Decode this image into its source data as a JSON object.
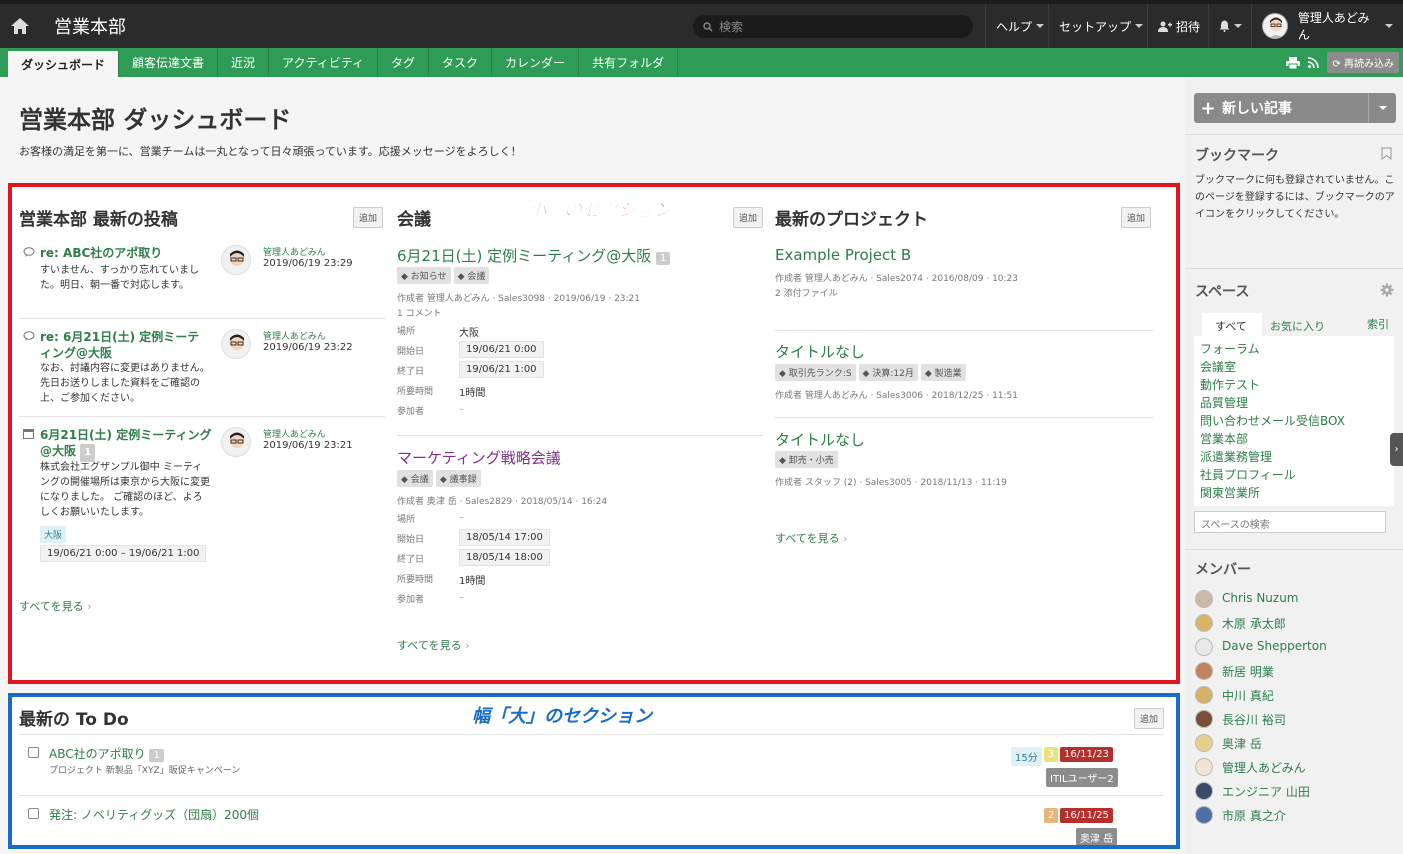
{
  "topbar": {
    "site_title": "営業本部",
    "search_placeholder": "検索",
    "help": "ヘルプ",
    "setup": "セットアップ",
    "invite": "招待",
    "user": "管理人あどみん"
  },
  "tabs": [
    "ダッシュボード",
    "顧客伝達文書",
    "近況",
    "アクティビティ",
    "タグ",
    "タスク",
    "カレンダー",
    "共有フォルダ"
  ],
  "reload": "再読み込み",
  "page": {
    "title": "営業本部 ダッシュボード",
    "description": "お客様の満足を第一に、営業チームは一丸となって日々頑張っています。応援メッセージをよろしく！"
  },
  "annotations": {
    "small": "幅「小」のセクション",
    "large": "幅「大」のセクション"
  },
  "add_label": "追加",
  "see_all": "すべてを見る",
  "posts": {
    "title": "営業本部 最新の投稿",
    "items": [
      {
        "title": "re: ABC社のアポ取り",
        "text": "すいません、すっかり忘れていました。明日、朝一番で対応します。",
        "author": "管理人あどみん",
        "date": "2019/06/19 23:29"
      },
      {
        "title": "re: 6月21日(土) 定例ミーティング@大阪",
        "text": "なお、討議内容に変更はありません。先日お送りしました資料をご確認の上、ご参加ください。",
        "author": "管理人あどみん",
        "date": "2019/06/19 23:22"
      },
      {
        "title": "6月21日(土) 定例ミーティング@大阪",
        "badge": "1",
        "text": "株式会社エグザンプル御中 ミーティングの開催場所は東京から大阪に変更になりました。 ご確認のほど、よろしくお願いいたします。",
        "author": "管理人あどみん",
        "date": "2019/06/19 23:21",
        "place": "大阪",
        "range": "19/06/21 0:00 – 19/06/21 1:00"
      }
    ]
  },
  "meetings": {
    "title": "会議",
    "labels": {
      "place": "場所",
      "start": "開始日",
      "end": "終了日",
      "duration": "所要時間",
      "attendees": "参加者"
    },
    "items": [
      {
        "title": "6月21日(土) 定例ミーティング@大阪",
        "badge": "1",
        "tags": [
          "お知らせ",
          "会議"
        ],
        "meta": "作成者 管理人あどみん · Sales3098 · 2019/06/19 · 23:21",
        "comments": "1 コメント",
        "place": "大阪",
        "start": "19/06/21 0:00",
        "end": "19/06/21 1:00",
        "duration": "1時間",
        "attendees": "–"
      },
      {
        "title": "マーケティング戦略会議",
        "tags": [
          "会議",
          "議事録"
        ],
        "meta": "作成者 奥津 岳 · Sales2829 · 2018/05/14 · 16:24",
        "place": "–",
        "start": "18/05/14 17:00",
        "end": "18/05/14 18:00",
        "duration": "1時間",
        "attendees": "–"
      }
    ]
  },
  "projects": {
    "title": "最新のプロジェクト",
    "items": [
      {
        "title": "Example Project B",
        "meta": "作成者 管理人あどみん · Sales2074 · 2016/08/09 · 10:23",
        "extra": "2 添付ファイル",
        "tags": []
      },
      {
        "title": "タイトルなし",
        "tags": [
          "取引先ランク:S",
          "決算:12月",
          "製造業"
        ],
        "meta": "作成者 管理人あどみん · Sales3006 · 2018/12/25 · 11:51"
      },
      {
        "title": "タイトルなし",
        "tags": [
          "卸売・小売"
        ],
        "meta": "作成者 スタッフ (2) · Sales3005 · 2018/11/13 · 11:19"
      }
    ]
  },
  "todo": {
    "title": "最新の To Do",
    "items": [
      {
        "title": "ABC社のアポ取り",
        "count": "1",
        "sub": "プロジェクト 新製品「XYZ」販促キャンペーン",
        "time": "15分",
        "priority": "3",
        "due": "16/11/23",
        "assignee": "ITILユーザー2"
      },
      {
        "title": "発注: ノベリティグッズ（団扇）200個",
        "priority": "2",
        "due": "16/11/25",
        "assignee": "奥津 岳"
      }
    ]
  },
  "sidebar": {
    "new_post": "新しい記事",
    "bookmark_title": "ブックマーク",
    "bookmark_text": "ブックマークに何も登録されていません。このページを登録するには、ブックマークのアイコンをクリックしてください。",
    "spaces_title": "スペース",
    "space_tabs": [
      "すべて",
      "お気に入り",
      "索引"
    ],
    "spaces": [
      "フォーラム",
      "会議室",
      "動作テスト",
      "品質管理",
      "問い合わせメール受信BOX",
      "営業本部",
      "派遣業務管理",
      "社員プロフィール",
      "関東営業所"
    ],
    "space_search": "スペースの検索",
    "members_title": "メンバー",
    "members": [
      "Chris Nuzum",
      "木原 承太郎",
      "Dave Shepperton",
      "新居 明業",
      "中川 真紀",
      "長谷川 裕司",
      "奥津 岳",
      "管理人あどみん",
      "エンジニア 山田",
      "市原 真之介"
    ]
  },
  "colors": {
    "accent_green": "#2e9c57",
    "red_outline": "#e0161f",
    "blue_outline": "#1a6cc4"
  }
}
